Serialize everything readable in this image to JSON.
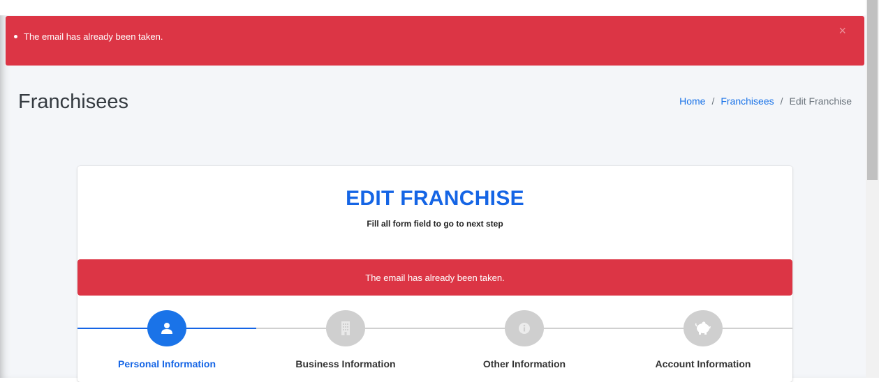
{
  "top_alert": {
    "message": "The email has already been taken.",
    "close_label": "×",
    "color": "#dc3545"
  },
  "header": {
    "title": "Franchisees",
    "breadcrumb": [
      {
        "label": "Home"
      },
      {
        "label": "Franchisees"
      },
      {
        "label": "Edit Franchise"
      }
    ],
    "separator": "/"
  },
  "card": {
    "title": "EDIT FRANCHISE",
    "subtitle": "Fill all form field to go to next step",
    "alert": "The email has already been taken.",
    "accent_color": "#1565e5"
  },
  "steps": [
    {
      "label": "Personal Information",
      "icon": "user-icon",
      "active": true
    },
    {
      "label": "Business Information",
      "icon": "building-icon",
      "active": false
    },
    {
      "label": "Other Information",
      "icon": "info-icon",
      "active": false
    },
    {
      "label": "Account Information",
      "icon": "piggy-bank-icon",
      "active": false
    }
  ]
}
